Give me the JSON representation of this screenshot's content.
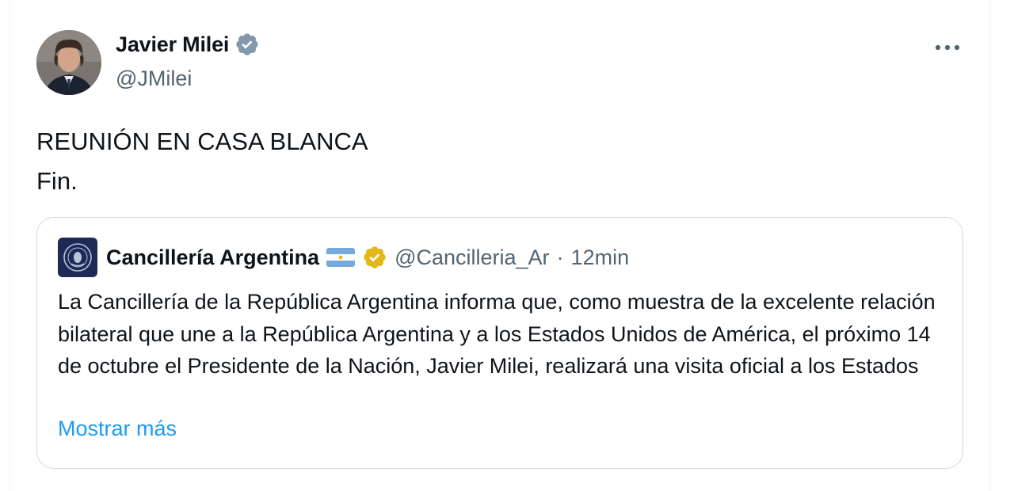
{
  "author": {
    "display_name": "Javier Milei",
    "handle": "@JMilei",
    "verified": true,
    "verified_color": "#829aab"
  },
  "tweet": {
    "text": "REUNIÓN EN CASA BLANCA\nFin."
  },
  "more_icon": "more-horizontal-icon",
  "quote": {
    "display_name": "Cancillería Argentina",
    "flag_icon": "argentina-flag-icon",
    "badge_color": "#e2b719",
    "handle": "@Cancilleria_Ar",
    "separator": "·",
    "time": "12min",
    "body": "La Cancillería de la República Argentina informa que, como muestra de la excelente relación bilateral que une a la República Argentina y a los Estados Unidos de América, el próximo 14 de octubre el Presidente de la Nación, Javier Milei, realizará una visita oficial a los Estados",
    "show_more": "Mostrar más"
  },
  "colors": {
    "text_primary": "#0f1419",
    "text_secondary": "#536471",
    "link": "#1d9bf0",
    "border": "#cfd9de"
  }
}
